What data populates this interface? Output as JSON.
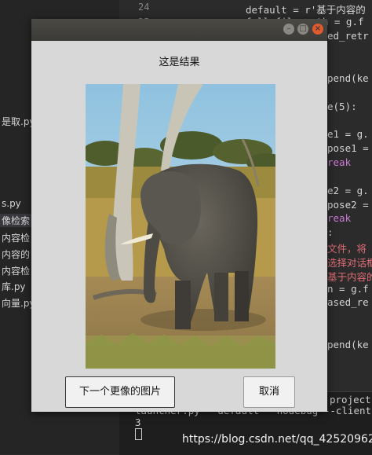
{
  "editor": {
    "line_numbers": [
      "24",
      "25"
    ],
    "code_lines": [
      {
        "text": "default = r'基于内容的",
        "kind": "plain"
      },
      {
        "text": "full_file_path = g.f",
        "kind": "plain"
      },
      {
        "text": "ed_retr",
        "kind": "plain"
      },
      {
        "text": "pend(ke",
        "kind": "plain"
      },
      {
        "text": "e(5):",
        "kind": "plain"
      },
      {
        "text": "e1 = g.",
        "kind": "plain"
      },
      {
        "text": "pose1 =",
        "kind": "plain"
      },
      {
        "text": "reak",
        "kind": "kw"
      },
      {
        "text": "e2 = g.",
        "kind": "plain"
      },
      {
        "text": "pose2 =",
        "kind": "plain"
      },
      {
        "text": "reak",
        "kind": "kw"
      },
      {
        "text": ":",
        "kind": "plain"
      },
      {
        "text": "文件，将",
        "kind": "str"
      },
      {
        "text": "选择对话框",
        "kind": "str"
      },
      {
        "text": "基于内容的",
        "kind": "str"
      },
      {
        "text": "n = g.f",
        "kind": "plain"
      },
      {
        "text": "ased_re",
        "kind": "plain"
      },
      {
        "text": "pend(ke",
        "kind": "plain"
      }
    ]
  },
  "file_panel": {
    "items": [
      "是取.py",
      "s.py",
      "像检索",
      "内容检",
      "内容的",
      "内容检",
      "库.py",
      "向量.py"
    ],
    "selected_index": 1
  },
  "terminal": {
    "lines": [
      "project",
      "launcher.py --default --nodebug --client",
      "3"
    ]
  },
  "watermark": "https://blog.csdn.net/qq_42520962",
  "dialog": {
    "title_buttons": [
      "–",
      "□",
      "×"
    ],
    "result_title": "这是结果",
    "image_alt": "elephant",
    "next_button": "下一个更像的图片",
    "cancel_button": "取消"
  },
  "colors": {
    "dialog_bg": "#d8d8d8",
    "titlebar": "#3c3b37",
    "close_button": "#e05a2d",
    "editor_bg": "#2b2b2b"
  }
}
